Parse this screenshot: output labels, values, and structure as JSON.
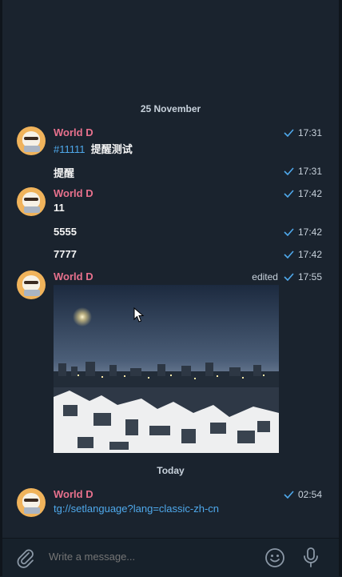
{
  "chat": {
    "date_separators": [
      "25 November",
      "Today"
    ],
    "messages": [
      {
        "sender": "World D",
        "hashtag": "#11111",
        "text": "提醒测试",
        "time": "17:31"
      },
      {
        "text": "提醒",
        "time": "17:31"
      },
      {
        "sender": "World D",
        "text": "11",
        "time": "17:42"
      },
      {
        "text": "5555",
        "time": "17:42"
      },
      {
        "text": "7777",
        "time": "17:42"
      },
      {
        "sender": "World D",
        "edited": "edited",
        "time": "17:55"
      },
      {
        "sender": "World D",
        "link": "tg://setlanguage?lang=classic-zh-cn",
        "time": "02:54"
      }
    ]
  },
  "composer": {
    "placeholder": "Write a message..."
  },
  "colors": {
    "background": "#1a232e",
    "sender": "#e8718d",
    "link": "#4fa9ec",
    "check": "#4fa9ec"
  },
  "icons": [
    "paperclip-icon",
    "emoji-icon",
    "microphone-icon",
    "checkmark-icon"
  ]
}
